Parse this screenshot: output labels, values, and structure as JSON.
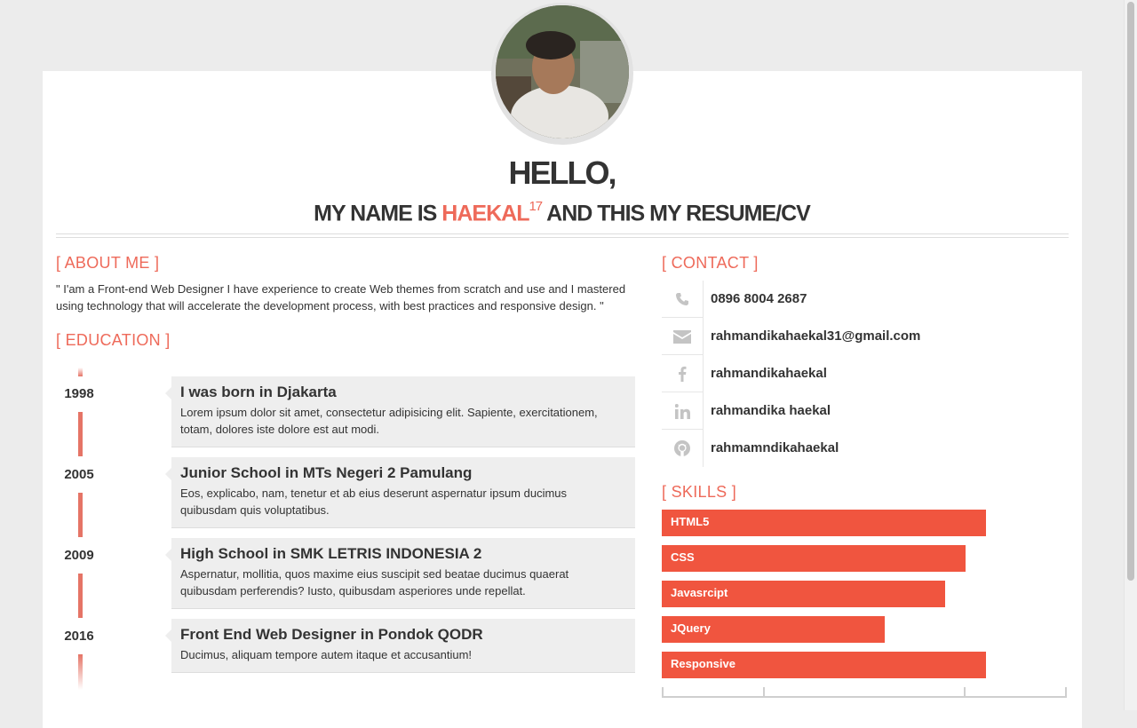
{
  "header": {
    "greeting": "HELLO,",
    "subtitle_prefix": "MY NAME IS ",
    "name": "HAEKAL",
    "name_sup": "17",
    "subtitle_suffix": " AND THIS MY RESUME/CV"
  },
  "about": {
    "title": "[ ABOUT ME ]",
    "text": "\" I'am a Front-end Web Designer I have experience to create Web themes from scratch and use and I mastered using technology that will accelerate the development process, with best practices and responsive design. \""
  },
  "education": {
    "title": "[ EDUCATION ]",
    "items": [
      {
        "year": "1998",
        "title": "I was born in Djakarta",
        "desc": "Lorem ipsum dolor sit amet, consectetur adipisicing elit. Sapiente, exercitationem, totam, dolores iste dolore est aut modi."
      },
      {
        "year": "2005",
        "title": "Junior School in MTs Negeri 2 Pamulang",
        "desc": "Eos, explicabo, nam, tenetur et ab eius deserunt aspernatur ipsum ducimus quibusdam quis voluptatibus."
      },
      {
        "year": "2009",
        "title": "High School in SMK LETRIS INDONESIA 2",
        "desc": "Aspernatur, mollitia, quos maxime eius suscipit sed beatae ducimus quaerat quibusdam perferendis? Iusto, quibusdam asperiores unde repellat."
      },
      {
        "year": "2016",
        "title": "Front End Web Designer in Pondok QODR",
        "desc": "Ducimus, aliquam tempore autem itaque et accusantium!"
      }
    ]
  },
  "contact": {
    "title": "[ CONTACT ]",
    "items": [
      {
        "icon": "phone-icon",
        "text": "0896 8004 2687"
      },
      {
        "icon": "envelope-icon",
        "text": "rahmandikahaekal31@gmail.com"
      },
      {
        "icon": "facebook-icon",
        "text": "rahmandikahaekal"
      },
      {
        "icon": "linkedin-icon",
        "text": "rahmandika haekal"
      },
      {
        "icon": "github-icon",
        "text": "rahmamndikahaekal"
      }
    ]
  },
  "skills": {
    "title": "[ SKILLS ]",
    "bar_color": "#f0553f",
    "items": [
      {
        "name": "HTML5",
        "level": 0.8
      },
      {
        "name": "CSS",
        "level": 0.75
      },
      {
        "name": "Javasrcipt",
        "level": 0.7
      },
      {
        "name": "JQuery",
        "level": 0.55
      },
      {
        "name": "Responsive",
        "level": 0.8
      }
    ]
  },
  "colors": {
    "accent": "#ee6a5a",
    "background": "#ececec",
    "card": "#ffffff"
  }
}
